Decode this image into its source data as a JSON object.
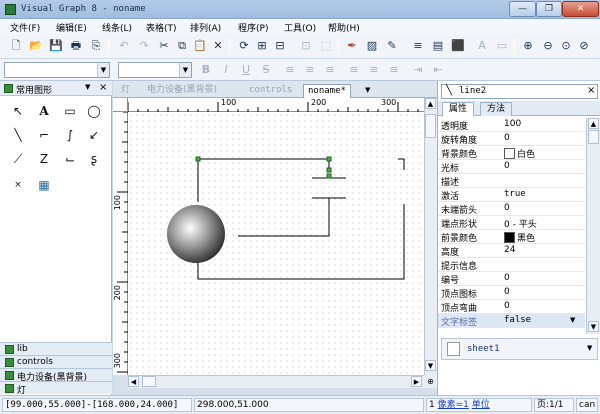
{
  "window": {
    "title": "Visual Graph 8 - noname",
    "min": "—",
    "max": "❐",
    "close": "✕"
  },
  "menu": [
    "文件(F)",
    "编辑(E)",
    "线条(L)",
    "表格(T)",
    "排列(A)",
    "程序(P)",
    "工具(O)",
    "帮助(H)"
  ],
  "toolbar1": [
    "🗋",
    "📂",
    "💾",
    "🖶",
    "⎘",
    "↶",
    "↷",
    "✂",
    "⧉",
    "📋",
    "✕",
    "⟳",
    "⊞",
    "⊟",
    "⊡",
    "⬚",
    "✒",
    "▨",
    "✎",
    "≡",
    "▤",
    "⬛",
    "A",
    "▭",
    "⊕",
    "⊖",
    "⊙",
    "⊘",
    "⊠"
  ],
  "toolbar2": [
    "B",
    "I",
    "U",
    "S",
    "≡",
    "≡",
    "≡",
    "≡",
    "≡",
    "≡",
    "⇥",
    "⇤"
  ],
  "left_panel": {
    "title": "常用图形",
    "tools": [
      "↖",
      "A",
      "▭",
      "◯",
      "╲",
      "⌐",
      "∫",
      "↙",
      "⟋",
      "Z",
      "⌙",
      "ʂ",
      "×",
      "▦"
    ],
    "libraries": [
      "lib",
      "controls",
      "电力设备(黑背景)",
      "灯"
    ]
  },
  "doc_tabs": [
    "灯",
    "电力设备(黑背景)",
    "controls",
    "noname*"
  ],
  "ruler": {
    "h": [
      "100",
      "200",
      "300"
    ],
    "v": [
      "100",
      "200",
      "300"
    ]
  },
  "properties": {
    "object": "line2",
    "tabs": [
      "属性",
      "方法"
    ],
    "rows": [
      {
        "k": "透明度",
        "v": "100"
      },
      {
        "k": "旋转角度",
        "v": "0"
      },
      {
        "k": "背景颜色",
        "v": "白色",
        "swatch": "#ffffff"
      },
      {
        "k": "光标",
        "v": "0"
      },
      {
        "k": "描述",
        "v": ""
      },
      {
        "k": "激活",
        "v": "true",
        "mono": true
      },
      {
        "k": "末端箭头",
        "v": "0"
      },
      {
        "k": "端点形状",
        "v": "0 - 平头"
      },
      {
        "k": "前景颜色",
        "v": "黑色",
        "swatch": "#000000"
      },
      {
        "k": "高度",
        "v": "24"
      },
      {
        "k": "提示信息",
        "v": ""
      },
      {
        "k": "编号",
        "v": "0"
      },
      {
        "k": "顶点图标",
        "v": "0"
      },
      {
        "k": "顶点弯曲",
        "v": "0"
      },
      {
        "k": "文字标签",
        "v": "false",
        "mono": true
      }
    ],
    "sheet": "sheet1"
  },
  "status": {
    "coords": "[99.000,55.000]-[168.000,24.000]",
    "position": "298.000,51.000",
    "selected_count_label": "1 ",
    "selected_count_link": "像素=1",
    "unit_label": "单位",
    "page": "页:1/1",
    "extra": "can"
  }
}
